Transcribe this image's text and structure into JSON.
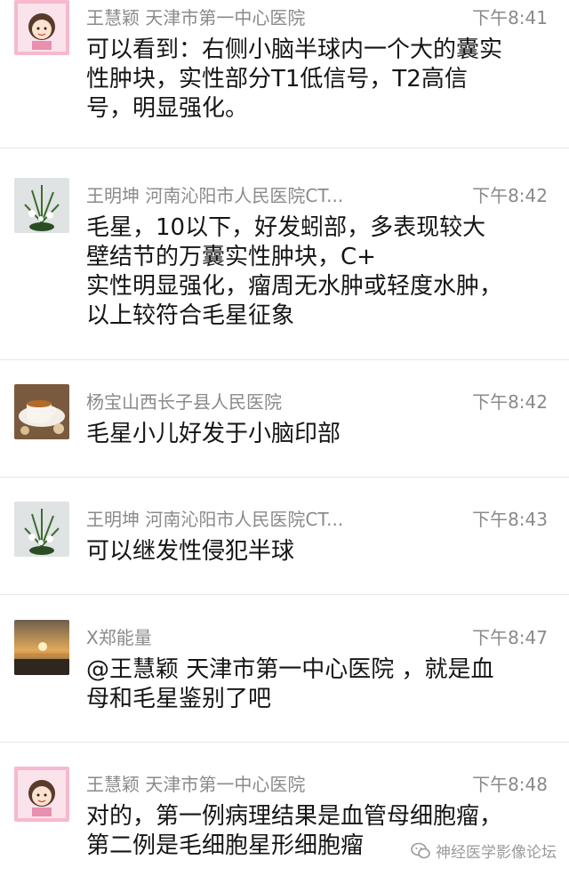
{
  "messages": [
    {
      "sender": "王慧颖 天津市第一中心医院",
      "time": "下午8:41",
      "avatar": "cartoon-girl-avatar",
      "lines": [
        "可以看到：右侧小脑半球内一个大的囊实",
        "性肿块，实性部分T1低信号，T2高信",
        "号，明显强化。"
      ]
    },
    {
      "sender": "王明坤  河南沁阳市人民医院CT...",
      "time": "下午8:42",
      "avatar": "flower-pot-avatar",
      "lines": [
        "毛星，10以下，好发蚓部，多表现较大",
        "壁结节的万囊实性肿块，C+",
        "实性明显强化，瘤周无水肿或轻度水肿，",
        "以上较符合毛星征象"
      ]
    },
    {
      "sender": "杨宝山西长子县人民医院",
      "time": "下午8:42",
      "avatar": "tea-cup-avatar",
      "lines": [
        "毛星小儿好发于小脑印部"
      ]
    },
    {
      "sender": "王明坤  河南沁阳市人民医院CT...",
      "time": "下午8:43",
      "avatar": "flower-pot-avatar",
      "lines": [
        "可以继发性侵犯半球"
      ]
    },
    {
      "sender": "X郑能量",
      "time": "下午8:47",
      "avatar": "sunset-beach-avatar",
      "lines": [
        "@王慧颖 天津市第一中心医院 ，就是血",
        "母和毛星鉴别了吧"
      ]
    },
    {
      "sender": "王慧颖 天津市第一中心医院",
      "time": "下午8:48",
      "avatar": "cartoon-girl-avatar",
      "lines": [
        "对的，第一例病理结果是血管母细胞瘤，",
        "第二例是毛细胞星形细胞瘤"
      ]
    }
  ],
  "watermark": {
    "text": "神经医学影像论坛",
    "icon": "wechat-official-account-icon"
  },
  "colors": {
    "meta_text": "#8a8a8a",
    "body_text": "#151515",
    "divider": "#e6e6e6"
  }
}
